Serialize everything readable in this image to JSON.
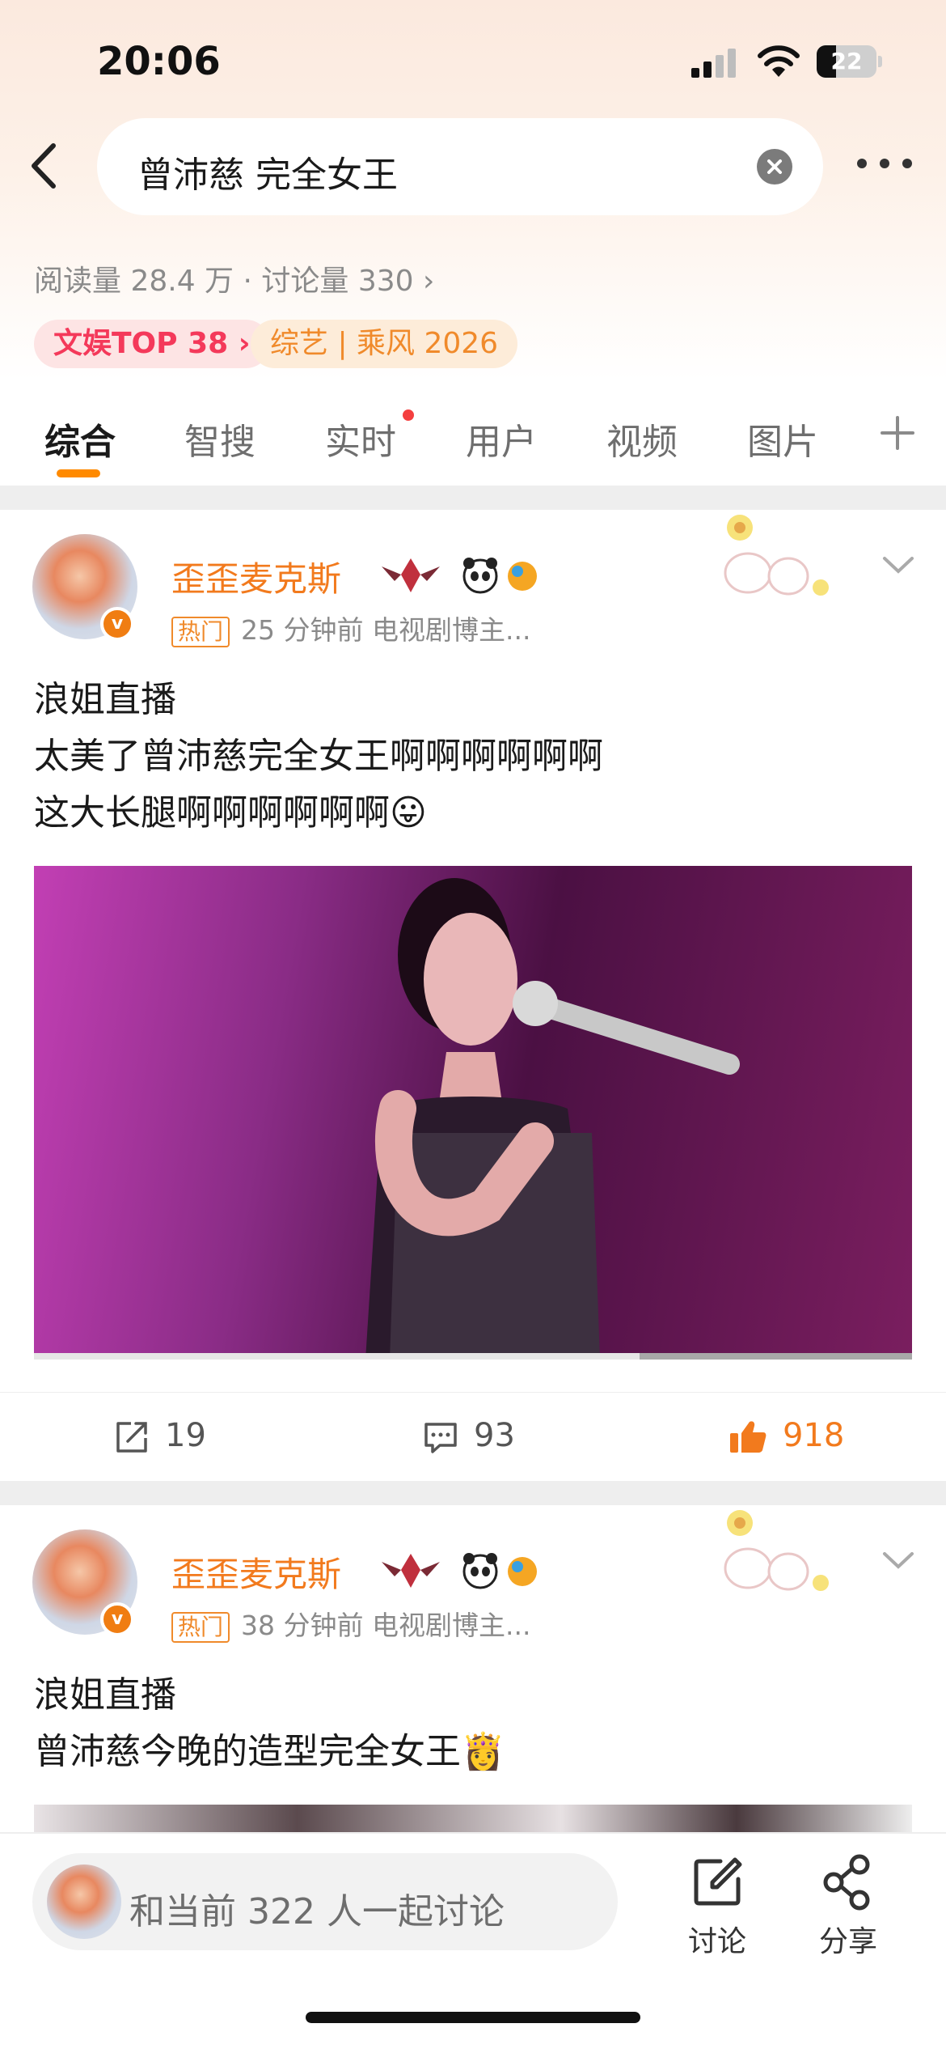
{
  "status_bar": {
    "time": "20:06",
    "battery": "22"
  },
  "search": {
    "query": "曾沛慈 完全女王"
  },
  "topic_stats": {
    "text": "阅读量 28.4 万 · 讨论量 330 ›"
  },
  "tags": {
    "rank": "文娱TOP 38 ›",
    "topic": "综艺 | 乘风 2026"
  },
  "tabs": [
    {
      "label": "综合"
    },
    {
      "label": "智搜"
    },
    {
      "label": "实时"
    },
    {
      "label": "用户"
    },
    {
      "label": "视频"
    },
    {
      "label": "图片"
    }
  ],
  "posts": [
    {
      "username": "歪歪麦克斯",
      "hot_label": "热门",
      "meta": "25 分钟前   电视剧博主...",
      "text": "浪姐直播\n太美了曾沛慈完全女王啊啊啊啊啊啊\n这大长腿啊啊啊啊啊啊",
      "emoji": "😛",
      "video_progress": 0.69,
      "reposts": "19",
      "comments": "93",
      "likes": "918"
    },
    {
      "username": "歪歪麦克斯",
      "hot_label": "热门",
      "meta": "38 分钟前   电视剧博主...",
      "text": "浪姐直播\n曾沛慈今晚的造型完全女王",
      "emoji": "👸"
    }
  ],
  "bottom_bar": {
    "discuss_placeholder": "和当前 322 人一起讨论",
    "discuss_label": "讨论",
    "share_label": "分享"
  },
  "colors": {
    "accent": "#f27a1d",
    "rank": "#f4395a",
    "tab_underline": "#ff8a00"
  }
}
